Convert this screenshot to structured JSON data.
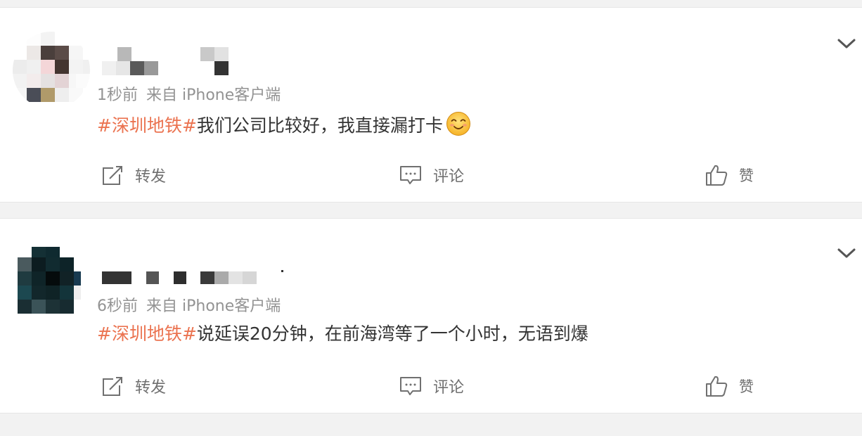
{
  "posts": [
    {
      "time": "1秒前",
      "source": "来自 iPhone客户端",
      "topic": "#深圳地铁#",
      "text": "我们公司比较好，我直接漏打卡",
      "emoji": "smile-emoji"
    },
    {
      "time": "6秒前",
      "source": "来自 iPhone客户端",
      "topic": "#深圳地铁#",
      "text": "说延误20分钟，在前海湾等了一个小时，无语到爆",
      "emoji": null
    }
  ],
  "actions": {
    "repost": "转发",
    "comment": "评论",
    "like": "赞"
  },
  "colors": {
    "topic": "#eb7350",
    "text": "#333333",
    "meta": "#939393",
    "action": "#707070",
    "background": "#f2f2f2"
  },
  "icons": {
    "menu": "chevron-down-icon",
    "repost": "repost-icon",
    "comment": "comment-icon",
    "like": "thumbs-up-icon"
  }
}
